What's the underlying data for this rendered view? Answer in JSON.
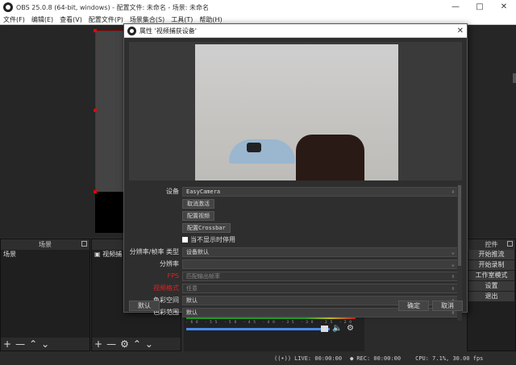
{
  "window": {
    "title": "OBS 25.0.8 (64-bit, windows) - 配置文件: 未命名 - 场景: 未命名"
  },
  "menu": [
    "文件(F)",
    "编辑(E)",
    "查看(V)",
    "配置文件(P)",
    "场景集合(S)",
    "工具(T)",
    "帮助(H)"
  ],
  "docks": {
    "scenes": {
      "title": "场景",
      "items": [
        "场景"
      ]
    },
    "sources": {
      "items": [
        "视频捕"
      ]
    },
    "controls": {
      "title": "控件",
      "buttons": [
        "开始推流",
        "开始录制",
        "工作室模式",
        "设置",
        "退出"
      ]
    }
  },
  "dialog": {
    "title": "属性 '视频捕获设备'",
    "labels": {
      "device": "设备",
      "res_type": "分辨率/帧率 类型",
      "resolution": "分辨率",
      "fps": "FPS",
      "video_format": "视频格式",
      "color_space": "色彩空间",
      "color_range": "色彩范围"
    },
    "values": {
      "device": "EasyCamera",
      "res_type": "设备默认",
      "resolution": "",
      "fps": "匹配输出帧率",
      "video_format": "任意",
      "color_space": "默认",
      "color_range": "默认"
    },
    "buttons": {
      "deactivate": "取消激活",
      "configure_video": "配置视频",
      "configure_crossbar": "配置Crossbar",
      "defaults": "默认",
      "ok": "确定",
      "cancel": "取消"
    },
    "checkbox_label": "当不显示时停用"
  },
  "audio": {
    "ticks": "-60 -55 -50 -45 -40 -35 -30 -25 -20 -15 -10 -5 0"
  },
  "status": {
    "live": "LIVE: 00:00:00",
    "rec": "REC: 00:00:00",
    "cpu": "CPU: 7.1%, 30.00 fps"
  }
}
